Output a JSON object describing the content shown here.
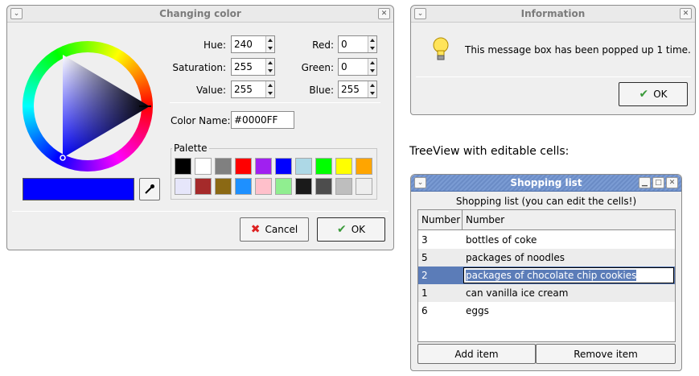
{
  "color_dialog": {
    "title": "Changing color",
    "hue_label": "Hue:",
    "hue_value": "240",
    "saturation_label": "Saturation:",
    "saturation_value": "255",
    "value_label": "Value:",
    "value_value": "255",
    "red_label": "Red:",
    "red_value": "0",
    "green_label": "Green:",
    "green_value": "0",
    "blue_label": "Blue:",
    "blue_value": "255",
    "color_name_label": "Color Name:",
    "color_name_value": "#0000FF",
    "palette_label": "Palette",
    "current_color": "#0000ff",
    "palette_row1": [
      "#000000",
      "#ffffff",
      "#808080",
      "#ff0000",
      "#a020f0",
      "#0000ff",
      "#add8e6",
      "#00ff00",
      "#ffff00",
      "#ffa500"
    ],
    "palette_row2": [
      "#e6e6fa",
      "#a52a2a",
      "#8b6914",
      "#1e90ff",
      "#ffc0cb",
      "#90ee90",
      "#1a1a1a",
      "#4d4d4d",
      "#bebebe",
      "#eeeeee"
    ],
    "cancel_label": "Cancel",
    "ok_label": "OK"
  },
  "info_dialog": {
    "title": "Information",
    "message": "This message box has been popped up 1 time.",
    "ok_label": "OK"
  },
  "treeview_caption": "TreeView with editable cells:",
  "shopping": {
    "title": "Shopping list",
    "subtitle": "Shopping list (you can edit the cells!)",
    "col_number": "Number",
    "col_product": "Number",
    "rows": [
      {
        "number": "3",
        "product": "bottles of coke"
      },
      {
        "number": "5",
        "product": "packages of noodles"
      },
      {
        "number": "2",
        "product": "packages of chocolate chip cookies"
      },
      {
        "number": "1",
        "product": "can vanilla ice cream"
      },
      {
        "number": "6",
        "product": "eggs"
      }
    ],
    "selected_row": 2,
    "add_label": "Add item",
    "remove_label": "Remove item"
  },
  "colors": {
    "selection": "#5b7cb8",
    "title_active": "#7f9fd6"
  }
}
